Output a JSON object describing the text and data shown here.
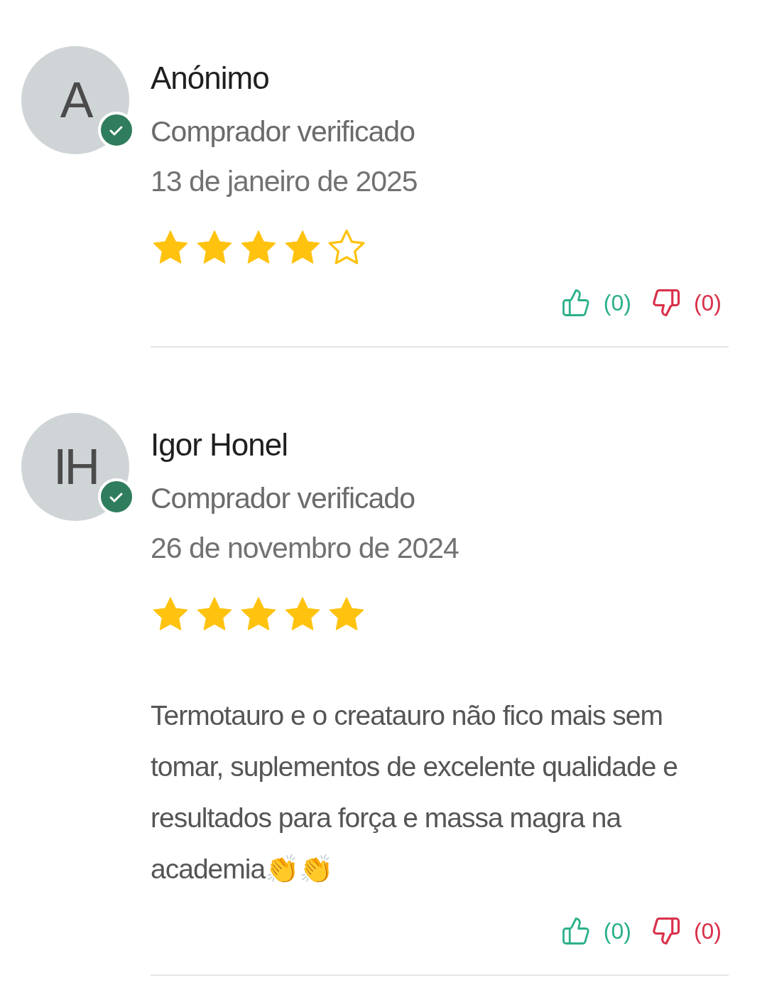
{
  "reviews": [
    {
      "initials": "A",
      "verified": true,
      "name": "Anónimo",
      "badge": "Comprador verificado",
      "date": "13 de janeiro de 2025",
      "stars": 4,
      "likes": "(0)",
      "dislikes": "(0)"
    },
    {
      "initials": "IH",
      "verified": true,
      "name": "Igor Honel",
      "badge": "Comprador verificado",
      "date": "26 de novembro de 2024",
      "stars": 5,
      "text": "Termotauro e o creatauro não fico mais sem tomar, suplementos de excelente qualidade e resultados para força e massa magra na academia👏👏",
      "likes": "(0)",
      "dislikes": "(0)"
    }
  ]
}
